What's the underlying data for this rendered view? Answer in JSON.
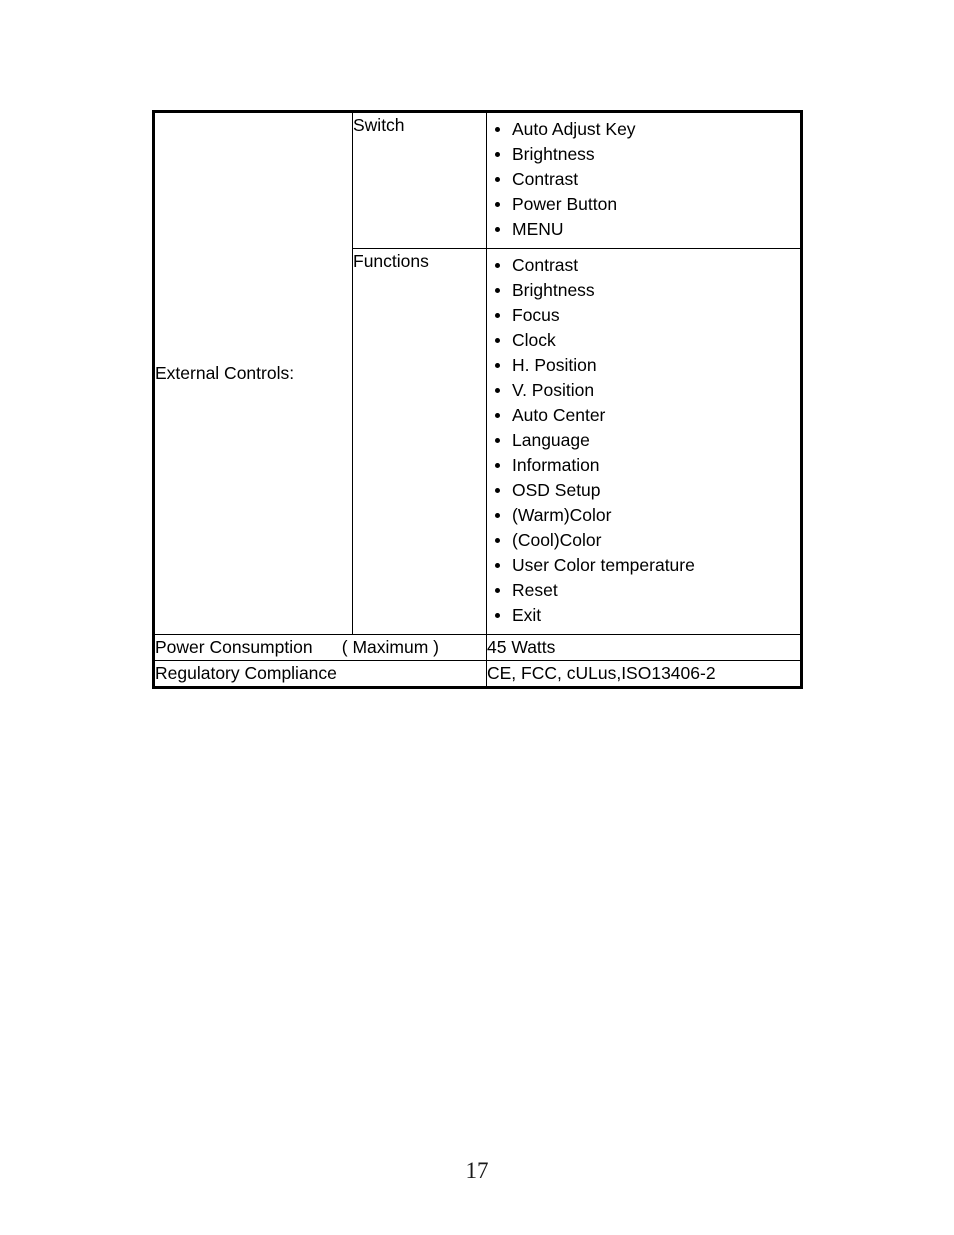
{
  "document": {
    "page_number": "17"
  },
  "spec_table": {
    "rows": [
      {
        "row_label": "External Controls:",
        "sub_rows": [
          {
            "sub_label": "Switch",
            "items": [
              "Auto Adjust Key",
              "Brightness",
              "Contrast",
              "Power Button",
              "MENU"
            ]
          },
          {
            "sub_label": "Functions",
            "items": [
              "Contrast",
              "Brightness",
              "Focus",
              "Clock",
              "H. Position",
              "V. Position",
              "Auto Center",
              "Language",
              "Information",
              "OSD Setup",
              "(Warm)Color",
              "(Cool)Color",
              "User Color temperature",
              "Reset",
              "Exit"
            ]
          }
        ]
      }
    ],
    "power_consumption": {
      "label": "Power Consumption      ( Maximum )",
      "value": "45 Watts"
    },
    "regulatory_compliance": {
      "label": "Regulatory Compliance",
      "value": "CE, FCC, cULus,ISO13406-2"
    }
  }
}
